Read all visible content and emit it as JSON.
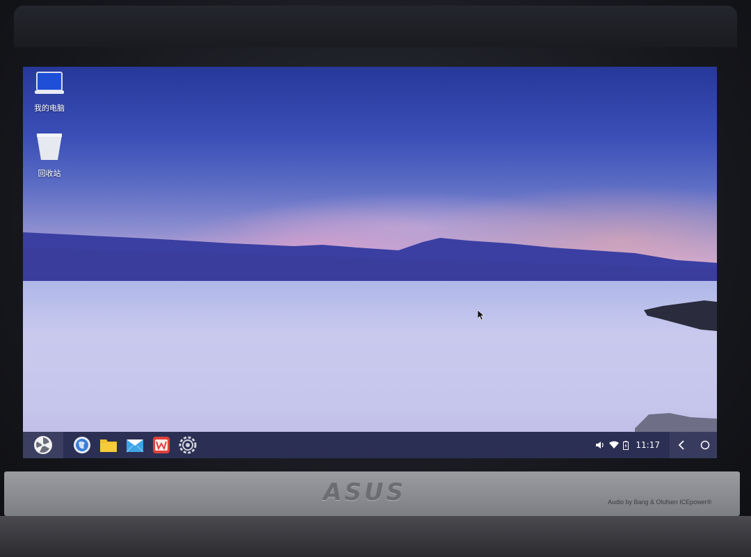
{
  "desktop": {
    "icons": [
      {
        "label": "我的电脑",
        "icon": "computer-icon"
      },
      {
        "label": "回收站",
        "icon": "trash-icon"
      }
    ]
  },
  "taskbar": {
    "start_icon": "start-menu-icon",
    "apps": [
      {
        "icon": "browser-icon",
        "color": "#3b7dd8"
      },
      {
        "icon": "file-manager-icon",
        "color": "#f2c12e"
      },
      {
        "icon": "mail-icon",
        "color": "#3ea6e6"
      },
      {
        "icon": "wps-office-icon",
        "color": "#e0413c"
      },
      {
        "icon": "settings-icon",
        "color": "#cfd3dc"
      }
    ],
    "tray": {
      "volume_icon": "volume-icon",
      "wifi_icon": "wifi-icon",
      "battery_icon": "battery-icon",
      "time": "11:17"
    },
    "back_icon": "back-icon",
    "home_icon": "home-icon"
  },
  "hardware": {
    "brand": "ASUS",
    "audio_text": "Audio by Bang & Olufsen ICEpower®"
  }
}
